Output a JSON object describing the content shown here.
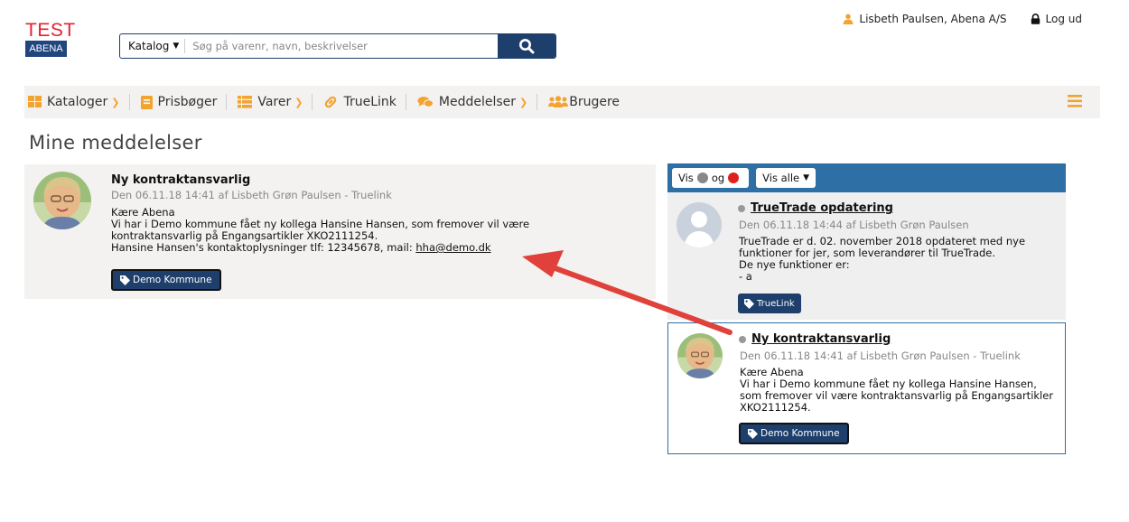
{
  "brand": {
    "test_label": "TEST",
    "abena_label": "ABENA"
  },
  "search": {
    "scope": "Katalog",
    "placeholder": "Søg på varenr, navn, beskrivelser"
  },
  "user": {
    "name": "Lisbeth Paulsen, Abena A/S",
    "logout": "Log ud"
  },
  "nav": {
    "items": [
      {
        "label": "Kataloger",
        "icon": "grid-icon"
      },
      {
        "label": "Prisbøger",
        "icon": "book-icon"
      },
      {
        "label": "Varer",
        "icon": "list-icon"
      },
      {
        "label": "TrueLink",
        "icon": "link-icon"
      },
      {
        "label": "Meddelelser",
        "icon": "chat-icon"
      },
      {
        "label": "Brugere",
        "icon": "users-icon"
      }
    ]
  },
  "page": {
    "title": "Mine meddelelser"
  },
  "main_message": {
    "title": "Ny kontraktansvarlig",
    "meta": "Den 06.11.18 14:41 af Lisbeth Grøn Paulsen - Truelink",
    "greeting": "Kære Abena",
    "line1": "Vi har i Demo kommune fået ny kollega Hansine Hansen, som fremover vil være",
    "line2": "kontraktansvarlig på Engangsartikler XKO2111254.",
    "line3_prefix": "Hansine Hansen's kontaktoplysninger tlf: 12345678, mail: ",
    "email": "hha@demo.dk",
    "tag": "Demo Kommune"
  },
  "panel": {
    "vis_label": "Vis",
    "og_label": "og",
    "vis_alle_label": "Vis alle",
    "colors": {
      "grey_dot": "#888888",
      "red_dot": "#e0201c",
      "header": "#2e6fa6",
      "accent": "#f2a330"
    },
    "messages": [
      {
        "title": "TrueTrade opdatering",
        "meta": "Den 06.11.18 14:44 af Lisbeth Grøn Paulsen",
        "lines": [
          "TrueTrade er d. 02. november 2018 opdateret med nye",
          "funktioner for jer, som leverandører til TrueTrade.",
          "De nye funktioner er:",
          "- a"
        ],
        "tag": "TrueLink"
      },
      {
        "title": "Ny kontraktansvarlig",
        "meta": "Den 06.11.18 14:41 af Lisbeth Grøn Paulsen - Truelink",
        "lines": [
          "Kære Abena",
          "Vi har i Demo kommune fået ny kollega Hansine Hansen,",
          "som fremover vil være kontraktansvarlig på Engangsartikler",
          "XKO2111254."
        ],
        "tag": "Demo Kommune"
      }
    ]
  }
}
